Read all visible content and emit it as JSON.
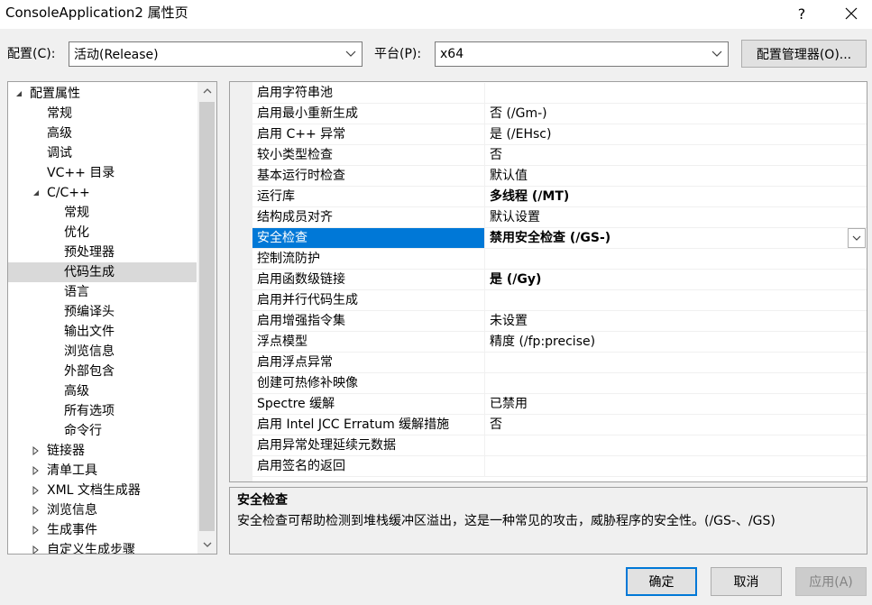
{
  "window": {
    "title": "ConsoleApplication2 属性页",
    "help_label": "?",
    "close_label": "✕"
  },
  "toolbar": {
    "config_label": "配置(C):",
    "config_value": "活动(Release)",
    "platform_label": "平台(P):",
    "platform_value": "x64",
    "config_manager_label": "配置管理器(O)..."
  },
  "tree": {
    "items": [
      {
        "label": "配置属性",
        "level": 0,
        "toggle": "expanded"
      },
      {
        "label": "常规",
        "level": 1
      },
      {
        "label": "高级",
        "level": 1
      },
      {
        "label": "调试",
        "level": 1
      },
      {
        "label": "VC++ 目录",
        "level": 1
      },
      {
        "label": "C/C++",
        "level": 1,
        "toggle": "expanded"
      },
      {
        "label": "常规",
        "level": 2
      },
      {
        "label": "优化",
        "level": 2
      },
      {
        "label": "预处理器",
        "level": 2
      },
      {
        "label": "代码生成",
        "level": 2,
        "selected": true
      },
      {
        "label": "语言",
        "level": 2
      },
      {
        "label": "预编译头",
        "level": 2
      },
      {
        "label": "输出文件",
        "level": 2
      },
      {
        "label": "浏览信息",
        "level": 2
      },
      {
        "label": "外部包含",
        "level": 2
      },
      {
        "label": "高级",
        "level": 2
      },
      {
        "label": "所有选项",
        "level": 2
      },
      {
        "label": "命令行",
        "level": 2
      },
      {
        "label": "链接器",
        "level": 1,
        "toggle": "collapsed"
      },
      {
        "label": "清单工具",
        "level": 1,
        "toggle": "collapsed"
      },
      {
        "label": "XML 文档生成器",
        "level": 1,
        "toggle": "collapsed"
      },
      {
        "label": "浏览信息",
        "level": 1,
        "toggle": "collapsed"
      },
      {
        "label": "生成事件",
        "level": 1,
        "toggle": "collapsed"
      },
      {
        "label": "自定义生成步骤",
        "level": 1,
        "toggle": "collapsed"
      }
    ]
  },
  "properties": [
    {
      "name": "启用字符串池",
      "value": ""
    },
    {
      "name": "启用最小重新生成",
      "value": "否 (/Gm-)"
    },
    {
      "name": "启用 C++ 异常",
      "value": "是 (/EHsc)"
    },
    {
      "name": "较小类型检查",
      "value": "否"
    },
    {
      "name": "基本运行时检查",
      "value": "默认值"
    },
    {
      "name": "运行库",
      "value": "多线程 (/MT)",
      "bold": true
    },
    {
      "name": "结构成员对齐",
      "value": "默认设置"
    },
    {
      "name": "安全检查",
      "value": "禁用安全检查 (/GS-)",
      "bold": true,
      "selected": true
    },
    {
      "name": "控制流防护",
      "value": ""
    },
    {
      "name": "启用函数级链接",
      "value": "是 (/Gy)",
      "bold": true
    },
    {
      "name": "启用并行代码生成",
      "value": ""
    },
    {
      "name": "启用增强指令集",
      "value": "未设置"
    },
    {
      "name": "浮点模型",
      "value": "精度 (/fp:precise)"
    },
    {
      "name": "启用浮点异常",
      "value": ""
    },
    {
      "name": "创建可热修补映像",
      "value": ""
    },
    {
      "name": "Spectre 缓解",
      "value": "已禁用"
    },
    {
      "name": "启用 Intel JCC Erratum 缓解措施",
      "value": "否"
    },
    {
      "name": "启用异常处理延续元数据",
      "value": ""
    },
    {
      "name": "启用签名的返回",
      "value": ""
    }
  ],
  "description": {
    "title": "安全检查",
    "text": "安全检查可帮助检测到堆栈缓冲区溢出，这是一种常见的攻击，威胁程序的安全性。(/GS-、/GS)"
  },
  "buttons": {
    "ok": "确定",
    "cancel": "取消",
    "apply": "应用(A)"
  },
  "colors": {
    "selection_accent": "#0078d7",
    "tree_selection": "#d9d9d9",
    "disabled_text": "#838383"
  }
}
